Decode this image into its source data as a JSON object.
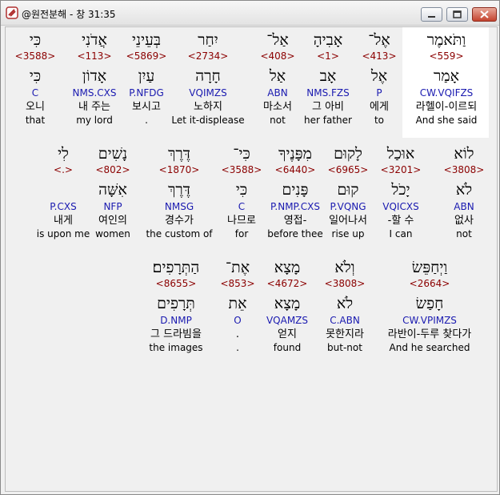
{
  "window": {
    "title": "@원전분해 - 창 31:35"
  },
  "icons": {
    "app": "app-logo-icon",
    "minimize": "minimize-icon",
    "maximize": "maximize-icon",
    "close": "close-icon"
  },
  "colors": {
    "strong": "#8b0000",
    "morph": "#1a1ab0",
    "text": "#000000"
  },
  "rows": [
    [
      {
        "heb": "כִּי",
        "strong": "<3588>",
        "lemma": "כִּי",
        "morph": "C",
        "kor": "오니",
        "eng": "that"
      },
      {
        "heb": "אֲדֹנִי",
        "strong": "<113>",
        "lemma": "אָדוֹן",
        "morph": "NMS.CXS",
        "kor": "내 주는",
        "eng": "my lord"
      },
      {
        "heb": "בְּעֵינֵי",
        "strong": "<5869>",
        "lemma": "עַיִן",
        "morph": "P.NFDG",
        "kor": "보시고",
        "eng": "."
      },
      {
        "heb": "יִחַר",
        "strong": "<2734>",
        "lemma": "חָרָה",
        "morph": "VQIMZS",
        "kor": "노하지",
        "eng": "Let it-displease"
      },
      {
        "heb": "אַל־",
        "strong": "<408>",
        "lemma": "אַל",
        "morph": "ABN",
        "kor": "마소서",
        "eng": "not"
      },
      {
        "heb": "אָבִיהָ",
        "strong": "<1>",
        "lemma": "אָב",
        "morph": "NMS.FZS",
        "kor": "그 아비",
        "eng": "her father"
      },
      {
        "heb": "אֶל־",
        "strong": "<413>",
        "lemma": "אֶל",
        "morph": "P",
        "kor": "에게",
        "eng": "to"
      },
      {
        "heb": "וַתֹּאמֶר",
        "strong": "<559>",
        "lemma": "אָמַר",
        "morph": "CW.VQIFZS",
        "kor": "라헬이-이르되",
        "eng": "And she said"
      }
    ],
    [
      {
        "heb": "לִי",
        "strong": "<.>",
        "lemma": "",
        "morph": "P.CXS",
        "kor": "내게",
        "eng": "is upon me"
      },
      {
        "heb": "נָשִׁים",
        "strong": "<802>",
        "lemma": "אִשָּׁה",
        "morph": "NFP",
        "kor": "여인의",
        "eng": "women"
      },
      {
        "heb": "דֶּרֶךְ",
        "strong": "<1870>",
        "lemma": "דֶּרֶךְ",
        "morph": "NMSG",
        "kor": "경수가",
        "eng": "the custom of"
      },
      {
        "heb": "כִּי־",
        "strong": "<3588>",
        "lemma": "כִּי",
        "morph": "C",
        "kor": "나므로",
        "eng": "for"
      },
      {
        "heb": "מִפָּנֶיךָ",
        "strong": "<6440>",
        "lemma": "פָּנִים",
        "morph": "P.NMP.CXS",
        "kor": "영접-",
        "eng": "before thee"
      },
      {
        "heb": "לָקוּם",
        "strong": "<6965>",
        "lemma": "קוּם",
        "morph": "P.VQNG",
        "kor": "일어나서",
        "eng": "rise up"
      },
      {
        "heb": "אוּכַל",
        "strong": "<3201>",
        "lemma": "יָכֹל",
        "morph": "VQICXS",
        "kor": "-할 수",
        "eng": "I can"
      },
      {
        "heb": "לוֹא",
        "strong": "<3808>",
        "lemma": "לֹא",
        "morph": "ABN",
        "kor": "없사",
        "eng": "not"
      }
    ],
    [
      {
        "heb": "הַתְּרָפִים׃",
        "strong": "<8655>",
        "lemma": "תְּרָפִים",
        "morph": "D.NMP",
        "kor": "그 드라빔을",
        "eng": "the images"
      },
      {
        "heb": "אֶת־",
        "strong": "<853>",
        "lemma": "אֵת",
        "morph": "O",
        "kor": ".",
        "eng": "."
      },
      {
        "heb": "מָצָא",
        "strong": "<4672>",
        "lemma": "מָצָא",
        "morph": "VQAMZS",
        "kor": "얻지",
        "eng": "found"
      },
      {
        "heb": "וְלֹא",
        "strong": "<3808>",
        "lemma": "לֹא",
        "morph": "C.ABN",
        "kor": "못한지라",
        "eng": "but-not"
      },
      {
        "heb": "וַיְחַפֵּשׂ",
        "strong": "<2664>",
        "lemma": "חָפַשׂ",
        "morph": "CW.VPIMZS",
        "kor": "라반이-두루 찾다가",
        "eng": "And he searched"
      }
    ]
  ]
}
